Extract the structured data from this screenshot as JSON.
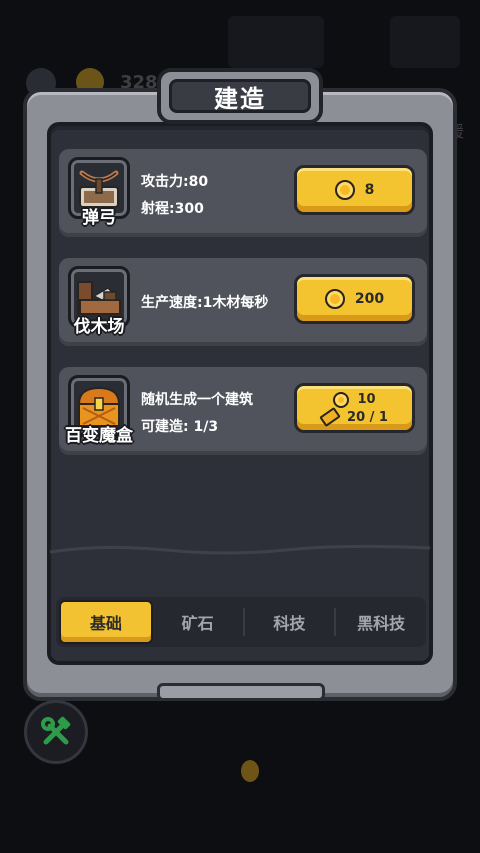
{
  "title": "建造",
  "background": {
    "coin_count": "328",
    "side_text": "援"
  },
  "cards": [
    {
      "name": "弹弓",
      "icon": "slingshot-icon",
      "stats": [
        "攻击力:80",
        "射程:300"
      ],
      "cost": "8"
    },
    {
      "name": "伐木场",
      "icon": "lumber-mill-icon",
      "stats": [
        "生产速度:1木材每秒"
      ],
      "cost": "200"
    },
    {
      "name": "百变魔盒",
      "icon": "treasure-chest-icon",
      "stats": [
        "随机生成一个建筑",
        "可建造: 1/3"
      ],
      "cost_coins": "10",
      "cost_tickets": "20 / 1"
    }
  ],
  "tabs": [
    {
      "label": "基础",
      "active": true
    },
    {
      "label": "矿石",
      "active": false
    },
    {
      "label": "科技",
      "active": false
    },
    {
      "label": "黑科技",
      "active": false
    }
  ],
  "colors": {
    "accent_yellow": "#f4c430",
    "panel_stone": "#8c8f96",
    "card_bg": "#51535c"
  }
}
